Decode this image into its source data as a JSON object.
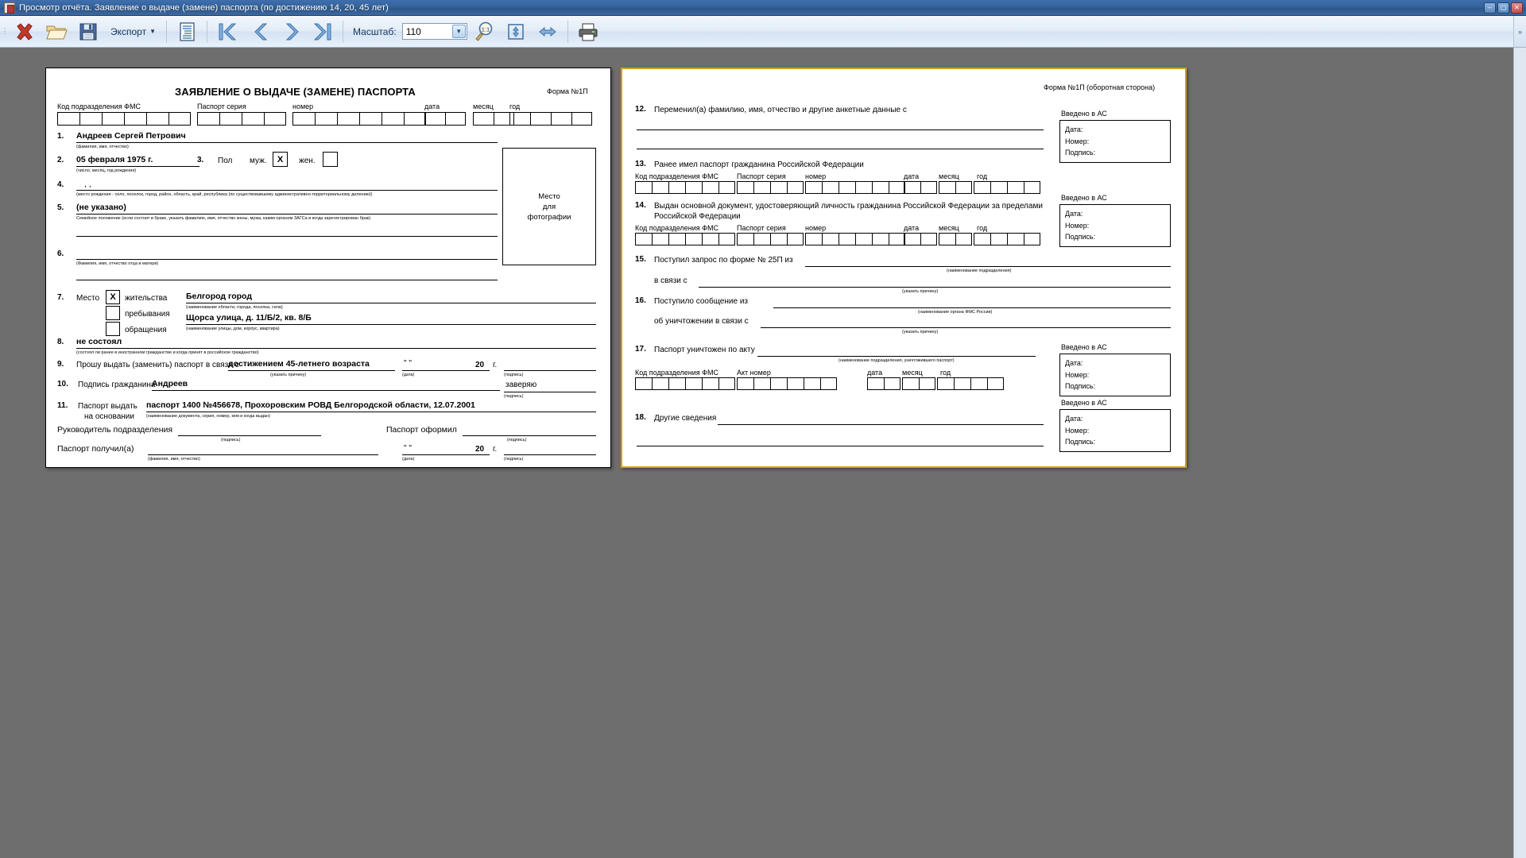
{
  "window": {
    "title": "Просмотр отчёта. Заявление о выдаче (замене) паспорта (по достижению 14, 20, 45 лет)",
    "icon": "report-icon",
    "minimize": "–",
    "maximize": "▢",
    "close": "✕"
  },
  "toolbar": {
    "close_label": "close-report-icon",
    "open_label": "open-icon",
    "save_label": "save-icon",
    "export_label": "Экспорт",
    "export_caret": "▼",
    "outline_label": "outline-icon",
    "first_page": "⏮",
    "prev_page": "❮",
    "next_page": "❯",
    "last_page": "⏭",
    "scale_label": "Масштаб:",
    "scale_value": "110",
    "scale_arrow": "▼",
    "actual_size": "1:1",
    "fit_page": "fit-page-icon",
    "fit_width": "fit-width-icon",
    "print": "print-icon",
    "overflow": "»"
  },
  "left_page": {
    "title": "ЗАЯВЛЕНИЕ О ВЫДАЧЕ (ЗАМЕНЕ) ПАСПОРТА",
    "form_no": "Форма №1П",
    "grid": {
      "code_label": "Код подразделения ФМС",
      "series_label": "Паспорт серия",
      "number_label": "номер",
      "date_label": "дата",
      "month_label": "месяц",
      "year_label": "год",
      "code_cells": 6,
      "series_cells": 4,
      "number_cells": 6,
      "date_cells": 2,
      "month_cells": 2,
      "year_cells": 4
    },
    "items": {
      "n1": "1.",
      "v1": "Андреев Сергей Петрович",
      "h1": "(фамилия, имя, отчество)",
      "n2": "2.",
      "v2": "05 февраля 1975 г.",
      "h2": "(число, месяц, год рождения)",
      "n3": "3.",
      "l3": "Пол",
      "l3m": "муж.",
      "l3m_mark": "X",
      "l3f": "жен.",
      "l3f_mark": "",
      "n4": "4.",
      "v4": ", ,",
      "h4": "(место рождения - село, поселок, город, район, область, край, республика (по существовавшему административно-территориальному делению))",
      "n5": "5.",
      "v5": "(не указано)",
      "h5": "Семейное положение (если состоит в браке, указать фамилию, имя, отчество жены, мужа, каким органом ЗАГСа и когда зарегистрирован брак)",
      "n6": "6.",
      "v6": "",
      "h6": "(Фамилия, имя, отчество отца и матери)",
      "n7": "7.",
      "l7": "Место",
      "l7_mark": "X",
      "l7a": "жительства",
      "l7b": "пребывания",
      "l7c": "обращения",
      "v7a": "Белгород город",
      "h7a": "(наименование области, города, поселка, села)",
      "v7b": "Щорса улица, д. 11/Б/2, кв. 8/Б",
      "h7b": "(наименование улицы, дом, корпус, квартира)",
      "n8": "8.",
      "v8": "не состоял",
      "h8": "(состоял ли ранее в иностранном гражданстве и когда принят в российское гражданство)",
      "n9": "9.",
      "l9": "Прошу выдать (заменить) паспорт в связи с",
      "v9": "достижением 45-летнего возраста",
      "h9": "(указать причину)",
      "l9_q": "\"            \"",
      "l9_year": "20",
      "l9_g": "г.",
      "h9_date": "(дата)",
      "h9_sign": "(подпись)",
      "n10": "10.",
      "l10": "Подпись гражданина",
      "v10": "Андреев",
      "l10_cert": "заверяю",
      "h10_sign": "(подпись)",
      "n11": "11.",
      "l11a": "Паспорт выдать",
      "l11b": "на основании",
      "v11": "паспорт 1400 №456678, Прохоровским РОВД Белгородской области, 12.07.2001",
      "h11": "(наименование документа, серия, номер, кем и когда выдан)",
      "l_head": "Руководитель подразделения",
      "h_head": "(подпись)",
      "l_issued": "Паспорт оформил",
      "h_issued": "(подпись)",
      "l_received": "Паспорт получил(а)",
      "h_received": "(фамилия, имя, отчество)",
      "l_rq": "\"         \"",
      "l_ryear": "20",
      "l_rg": "г.",
      "h_rdate": "(дата)",
      "h_rsign": "(подпись)"
    },
    "photo": {
      "l1": "Место",
      "l2": "для",
      "l3": "фотографии"
    }
  },
  "right_page": {
    "form_no": "Форма №1П (оборотная сторона)",
    "items": {
      "n12": "12.",
      "l12": "Переменил(а) фамилию, имя, отчество и другие анкетные данные с",
      "n13": "13.",
      "l13": "Ранее имел паспорт гражданина Российской Федерации",
      "n14": "14.",
      "l14a": "Выдан основной документ, удостоверяющий личность гражданина Российской Федерации за пределами",
      "l14b": "Российской Федерации",
      "n15": "15.",
      "l15": "Поступил запрос по форме № 25П из",
      "h15": "(наименование подразделения)",
      "l15b": "в связи с",
      "h15b": "(указать причину)",
      "n16": "16.",
      "l16": "Поступило сообщение из",
      "h16": "(наименование органа ФМС России)",
      "l16b": "об уничтожении в связи с",
      "h16b": "(указать причину)",
      "n17": "17.",
      "l17": "Паспорт уничтожен по акту",
      "h17": "(наименование подразделения, уничтожившего паспорт)",
      "act_label": "Акт номер",
      "n18": "18.",
      "l18": "Другие сведения"
    },
    "grid": {
      "code_label": "Код подразделения ФМС",
      "series_label": "Паспорт серия",
      "number_label": "номер",
      "date_label": "дата",
      "month_label": "месяц",
      "year_label": "год"
    },
    "as_blocks": [
      {
        "caption": "Введено в АС",
        "date": "Дата:",
        "number": "Номер:",
        "sign": "Подпись:"
      },
      {
        "caption": "Введено в АС",
        "date": "Дата:",
        "number": "Номер:",
        "sign": "Подпись:"
      },
      {
        "caption": "Введено в АС",
        "date": "Дата:",
        "number": "Номер:",
        "sign": "Подпись:"
      },
      {
        "caption": "Введено в АС",
        "date": "Дата:",
        "number": "Номер:",
        "sign": "Подпись:"
      }
    ]
  },
  "colors": {
    "title_bar": "#35639a",
    "page_border_active": "#d3a017",
    "viewer_bg": "#6e6e6e",
    "toolbar_bg": "#e3ecf7"
  }
}
